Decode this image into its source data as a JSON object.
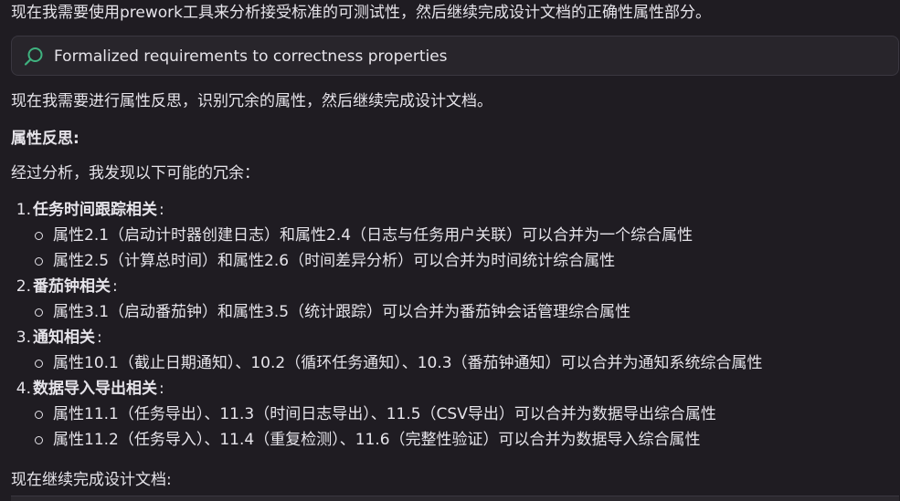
{
  "messages": {
    "intro": "现在我需要使用prework工具来分析接受标准的可测试性，然后继续完成设计文档的正确性属性部分。",
    "tool_call": {
      "icon": "search-icon",
      "label": "Formalized requirements to correctness properties"
    },
    "p2": "现在我需要进行属性反思，识别冗余的属性，然后继续完成设计文档。",
    "heading": "属性反思:",
    "p3": "经过分析，我发现以下可能的冗余：",
    "groups": [
      {
        "num": "1.",
        "title": "任务时间跟踪相关",
        "items": [
          "属性2.1（启动计时器创建日志）和属性2.4（日志与任务用户关联）可以合并为一个综合属性",
          "属性2.5（计算总时间）和属性2.6（时间差异分析）可以合并为时间统计综合属性"
        ]
      },
      {
        "num": "2.",
        "title": "番茄钟相关",
        "items": [
          "属性3.1（启动番茄钟）和属性3.5（统计跟踪）可以合并为番茄钟会话管理综合属性"
        ]
      },
      {
        "num": "3.",
        "title": "通知相关",
        "items": [
          "属性10.1（截止日期通知）、10.2（循环任务通知）、10.3（番茄钟通知）可以合并为通知系统综合属性"
        ]
      },
      {
        "num": "4.",
        "title": "数据导入导出相关",
        "items": [
          "属性11.1（任务导出）、11.3（时间日志导出）、11.5（CSV导出）可以合并为数据导出综合属性",
          "属性11.2（任务导入）、11.4（重复检测）、11.6（完整性验证）可以合并为数据导入综合属性"
        ]
      }
    ],
    "outro": "现在继续完成设计文档:"
  },
  "colors": {
    "background": "#1f1c22",
    "text": "#e6e4ea",
    "tool_bg": "#28252b",
    "tool_icon": "#3fb27f"
  }
}
